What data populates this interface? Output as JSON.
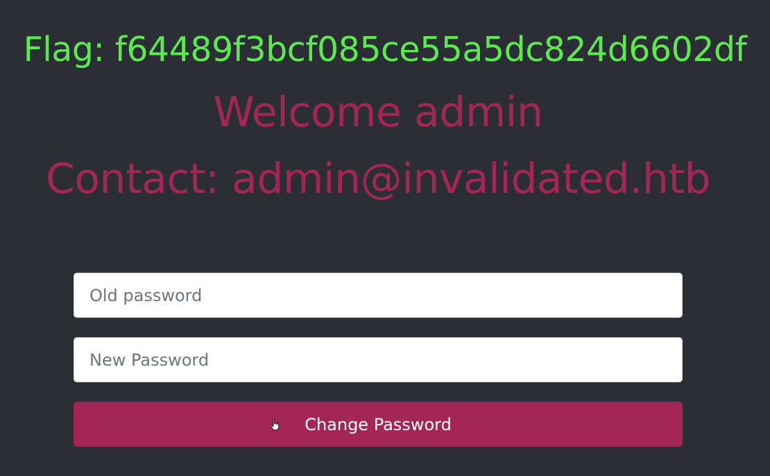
{
  "header": {
    "flag_text": "Flag: f64489f3bcf085ce55a5dc824d6602df",
    "welcome_text": "Welcome admin",
    "contact_text": "Contact: admin@invalidated.htb"
  },
  "form": {
    "old_password": {
      "value": "",
      "placeholder": "Old password"
    },
    "new_password": {
      "value": "",
      "placeholder": "New Password"
    },
    "submit_label": "Change Password"
  },
  "colors": {
    "background": "#2b2f35",
    "flag": "#5cea4f",
    "accent": "#a32655"
  },
  "icons": {
    "pointer": "hand-pointer-cursor-icon"
  }
}
